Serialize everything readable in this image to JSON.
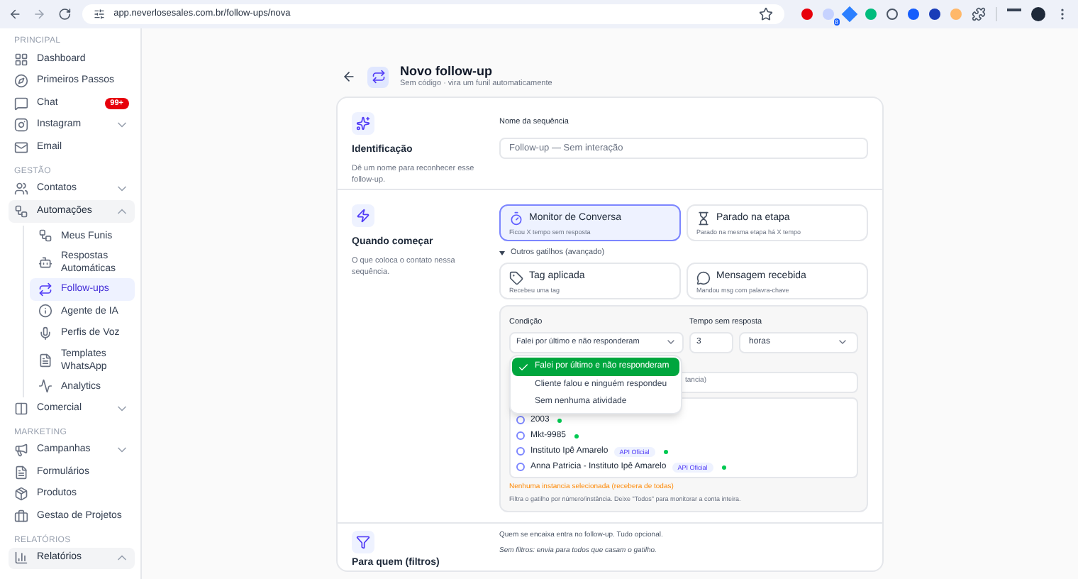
{
  "browser": {
    "url": "app.neverlosesales.com.br/follow-ups/nova",
    "badge": "8"
  },
  "sidebar": {
    "sections": [
      {
        "heading": "PRINCIPAL",
        "items": [
          {
            "label": "Dashboard",
            "selected": false
          },
          {
            "label": "Primeiros Passos",
            "selected": false
          },
          {
            "label": "Chat",
            "badge": "99+",
            "selected": false
          },
          {
            "label": "Instagram",
            "expanded": false,
            "selected": false
          },
          {
            "label": "Email",
            "selected": false
          }
        ]
      },
      {
        "heading": "GESTÃO",
        "items": [
          {
            "label": "Contatos",
            "expanded": false,
            "selected": false
          },
          {
            "label": "Automações",
            "expanded": true,
            "selected": false,
            "children": [
              {
                "label": "Meus Funis",
                "selected": false
              },
              {
                "label": "Respostas Automáticas",
                "selected": false
              },
              {
                "label": "Follow-ups",
                "selected": true
              },
              {
                "label": "Agente de IA",
                "selected": false
              },
              {
                "label": "Perfis de Voz",
                "selected": false
              },
              {
                "label": "Templates WhatsApp",
                "selected": false
              },
              {
                "label": "Analytics",
                "selected": false
              }
            ]
          },
          {
            "label": "Comercial",
            "expanded": false,
            "selected": false
          }
        ]
      },
      {
        "heading": "MARKETING",
        "items": [
          {
            "label": "Campanhas",
            "expanded": false,
            "selected": false
          },
          {
            "label": "Formulários",
            "selected": false
          },
          {
            "label": "Produtos",
            "selected": false
          },
          {
            "label": "Gestao de Projetos",
            "selected": false
          }
        ]
      },
      {
        "heading": "RELATÓRIOS",
        "items": [
          {
            "label": "Relatórios",
            "expanded": true,
            "selected": false
          }
        ]
      }
    ]
  },
  "header": {
    "title": "Novo follow-up",
    "subtitle": "Sem código · vira um funil automaticamente"
  },
  "identification": {
    "title": "Identificação",
    "description": "Dê um nome para reconhecer esse follow-up.",
    "field": {
      "label": "Nome da sequência",
      "placeholder": "Follow-up — Sem interação"
    }
  },
  "trigger": {
    "title": "Quando começar",
    "description": "O que coloca o contato nessa sequência.",
    "options": [
      {
        "title": "Monitor de Conversa",
        "subtitle": "Ficou X tempo sem resposta",
        "selected": true
      },
      {
        "title": "Parado na etapa",
        "subtitle": "Parado na mesma etapa há X tempo",
        "selected": false
      }
    ],
    "advanced": {
      "label": "Outros gatilhos (avançado)",
      "expanded": true
    },
    "advanced_options": [
      {
        "title": "Tag aplicada",
        "subtitle": "Recebeu uma tag",
        "selected": false
      },
      {
        "title": "Mensagem recebida",
        "subtitle": "Mandou msg com palavra-chave",
        "selected": false
      }
    ],
    "panel": {
      "condition": {
        "label": "Condição",
        "value": "Falei por último e não responderam"
      },
      "wait": {
        "label": "Tempo sem resposta",
        "value": "3",
        "unit": "horas"
      },
      "condition_options": [
        {
          "label": "Falei por último e não responderam",
          "selected": true
        },
        {
          "label": "Cliente falou e ninguém respondeu",
          "selected": false
        },
        {
          "label": "Sem nenhuma atividade",
          "selected": false
        }
      ],
      "instance_field": "tancia)",
      "instances": [
        {
          "name": "2003",
          "checked": false,
          "online": true
        },
        {
          "name": "Mkt-9985",
          "checked": false,
          "online": true
        },
        {
          "name": "Instituto Ipê Amarelo",
          "badge": "API Oficial",
          "checked": false,
          "online": true
        },
        {
          "name": "Anna Patricia - Instituto Ipê Amarelo",
          "badge": "API Oficial",
          "checked": false,
          "online": true
        }
      ],
      "warning": "Nenhuma instancia selecionada (recebera de todas)",
      "help": "Filtra o gatilho por número/instância. Deixe \"Todos\" para monitorar a conta inteira."
    }
  },
  "filters": {
    "title": "Para quem (filtros)",
    "intro": "Quem se encaixa entra no follow-up. Tudo opcional.",
    "note": "Sem filtros: envia para todos que casam o gatilho."
  }
}
